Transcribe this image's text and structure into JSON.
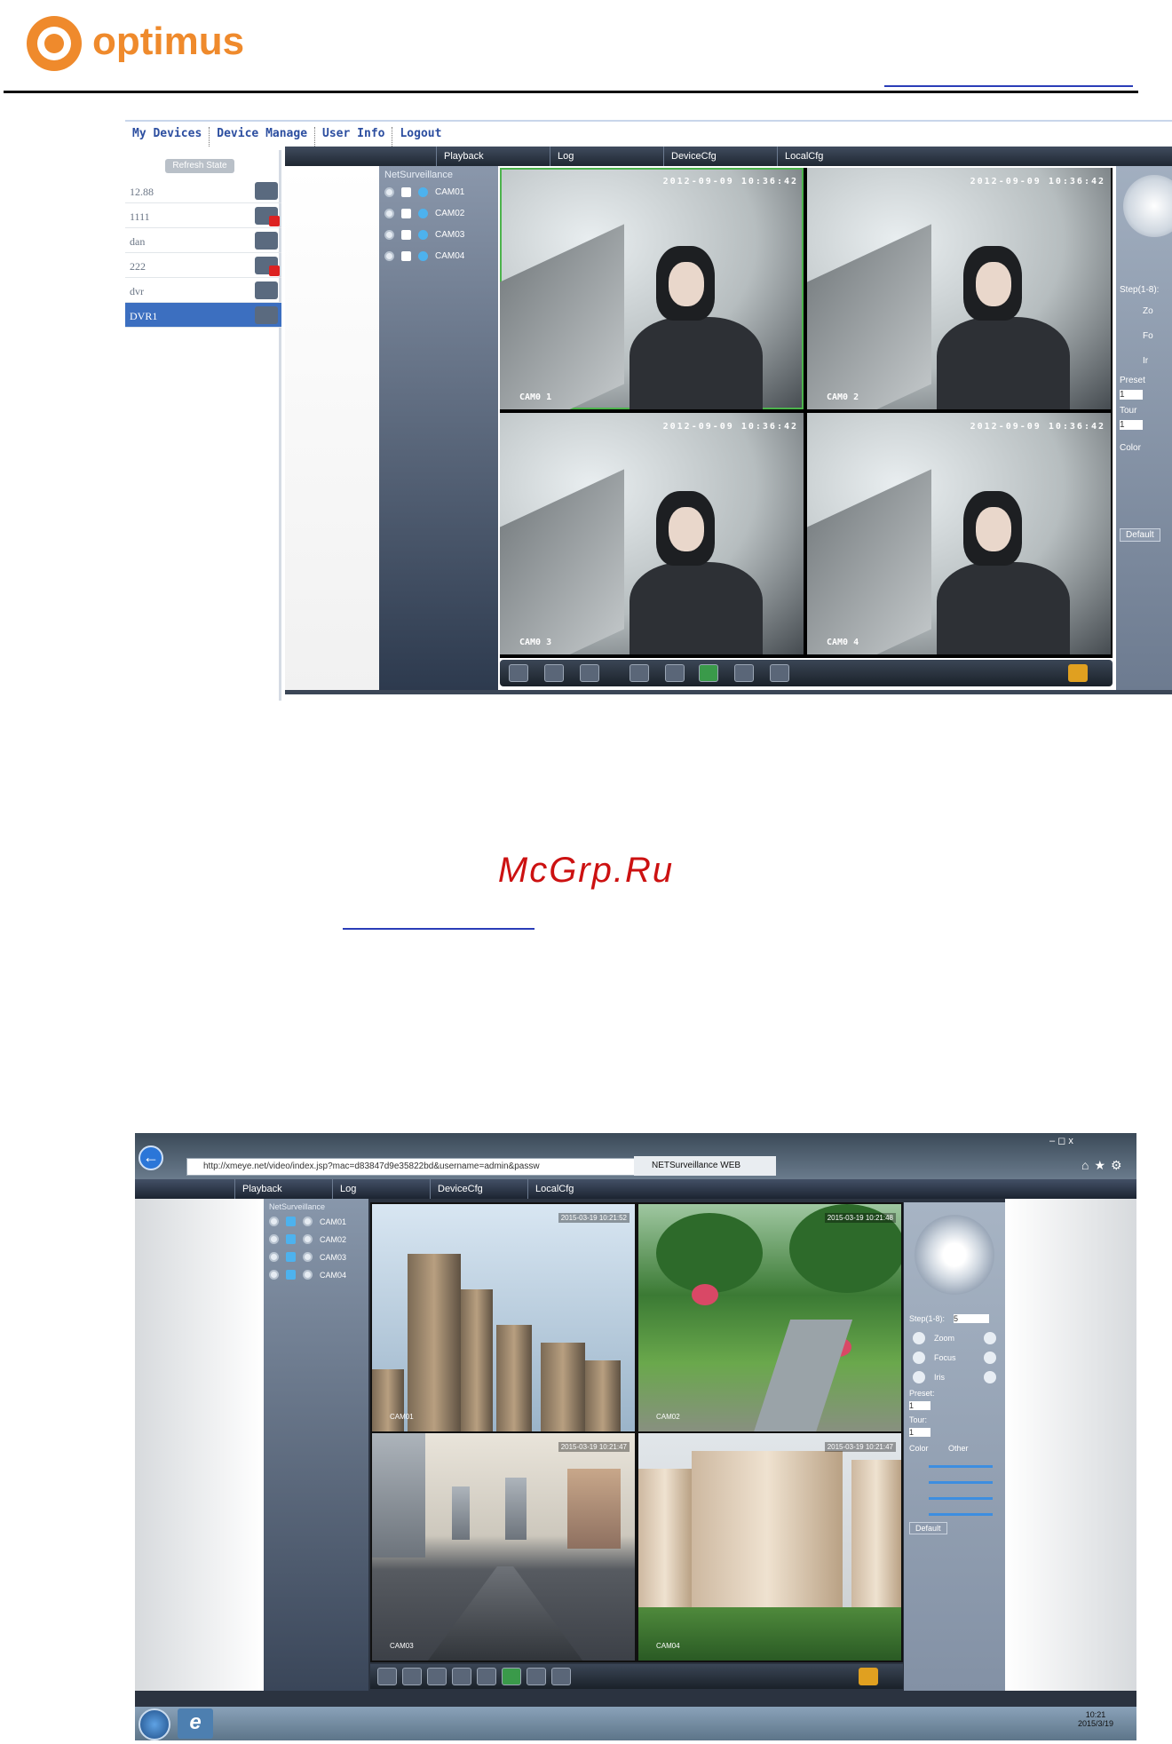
{
  "header": {
    "brand": "optimus"
  },
  "watermark": "McGrp.Ru",
  "screenshot1": {
    "top_nav": [
      "My Devices",
      "Device Manage",
      "User Info",
      "Logout"
    ],
    "refresh_label": "Refresh State",
    "devices": [
      {
        "name": "12.88",
        "status": "online"
      },
      {
        "name": "1111",
        "status": "offline"
      },
      {
        "name": "dan",
        "status": "online"
      },
      {
        "name": "222",
        "status": "offline"
      },
      {
        "name": "dvr",
        "status": "online"
      },
      {
        "name": "DVR1",
        "status": "online",
        "selected": true
      }
    ],
    "tabs": [
      "Playback",
      "Log",
      "DeviceCfg",
      "LocalCfg"
    ],
    "tree_root": "NetSurveillance",
    "channels": [
      "CAM01",
      "CAM02",
      "CAM03",
      "CAM04"
    ],
    "feeds": [
      {
        "label": "CAM0 1",
        "timestamp": "2012-09-09 10:36:42"
      },
      {
        "label": "CAM0 2",
        "timestamp": "2012-09-09 10:36:42"
      },
      {
        "label": "CAM0 3",
        "timestamp": "2012-09-09 10:36:42"
      },
      {
        "label": "CAM0 4",
        "timestamp": "2012-09-09 10:36:42"
      }
    ],
    "ptz": {
      "step": "Step(1-8):",
      "zoom": "Zo",
      "focus": "Fo",
      "iris": "Ir",
      "preset": "Preset",
      "preset_val": "1",
      "tour": "Tour",
      "tour_val": "1",
      "color": "Color",
      "default": "Default"
    }
  },
  "screenshot2": {
    "url": "http://xmeye.net/video/index.jsp?mac=d83847d9e35822bd&username=admin&passw",
    "browser_tab": "NETSurveillance WEB",
    "window_controls": "–  ◻  x",
    "tabs": [
      "Playback",
      "Log",
      "DeviceCfg",
      "LocalCfg"
    ],
    "tree_root": "NetSurveillance",
    "channels": [
      "CAM01",
      "CAM02",
      "CAM03",
      "CAM04"
    ],
    "feeds": [
      {
        "label": "CAM01",
        "timestamp": "2015-03-19 10:21:52"
      },
      {
        "label": "CAM02",
        "timestamp": "2015-03-19 10:21:48"
      },
      {
        "label": "CAM03",
        "timestamp": "2015-03-19 10:21:47"
      },
      {
        "label": "CAM04",
        "timestamp": "2015-03-19 10:21:47"
      }
    ],
    "ptz": {
      "step": "Step(1-8):",
      "step_val": "5",
      "zoom": "Zoom",
      "focus": "Focus",
      "iris": "Iris",
      "preset": "Preset:",
      "preset_val": "1",
      "tour": "Tour:",
      "tour_val": "1",
      "color_tab": "Color",
      "other_tab": "Other",
      "default": "Default"
    },
    "clock_time": "10:21",
    "clock_date": "2015/3/19"
  }
}
